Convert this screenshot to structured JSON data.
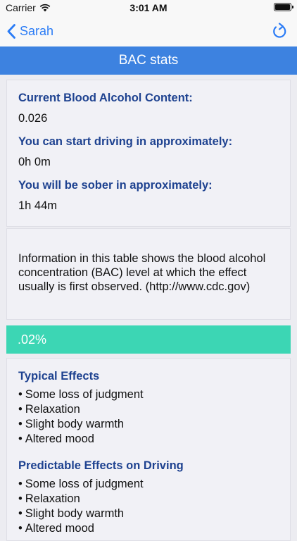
{
  "status_bar": {
    "carrier": "Carrier",
    "time": "3:01 AM"
  },
  "nav": {
    "back_label": "Sarah"
  },
  "title": "BAC stats",
  "stats": [
    {
      "label": "Current Blood Alcohol Content:",
      "value": "0.026"
    },
    {
      "label": "You can start driving in approximately:",
      "value": "0h 0m"
    },
    {
      "label": "You will be sober in approximately:",
      "value": "1h 44m"
    }
  ],
  "info_text": "Information in this table shows the blood alcohol concentration (BAC) level at which the effect usually is first observed. (http://www.cdc.gov)",
  "level": ".02%",
  "effects": {
    "typical_heading": "Typical Effects",
    "typical_items": [
      "Some loss of judgment",
      "Relaxation",
      "Slight body warmth",
      "Altered mood"
    ],
    "driving_heading": "Predictable Effects on Driving",
    "driving_items": [
      "Some loss of judgment",
      "Relaxation",
      "Slight body warmth",
      "Altered mood"
    ]
  },
  "colors": {
    "accent": "#2b7cf6",
    "title_bar": "#3d82e0",
    "level_bar": "#3cd6b4",
    "heading": "#1e4290"
  },
  "icons": {
    "back": "chevron-left-icon",
    "refresh": "refresh-icon",
    "wifi": "wifi-icon",
    "battery": "battery-icon"
  }
}
